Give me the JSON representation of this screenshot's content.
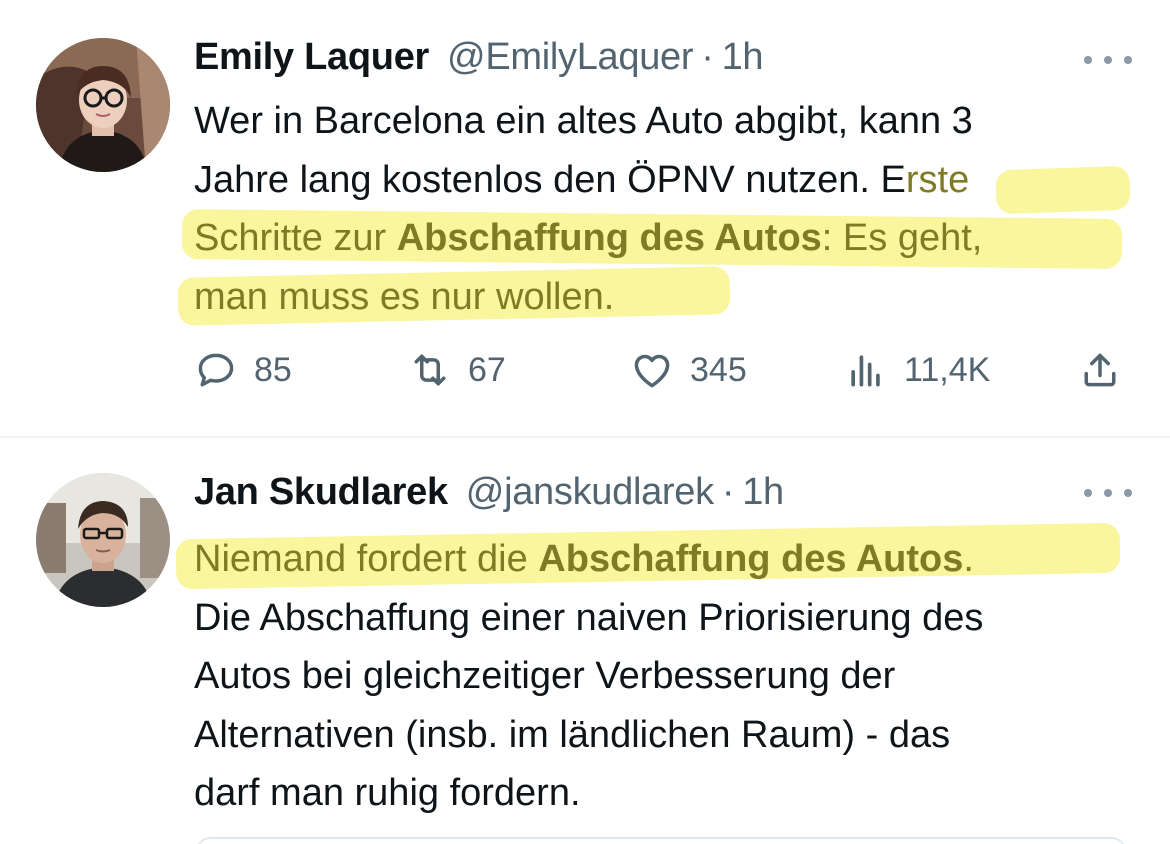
{
  "tweets": [
    {
      "name": "Emily Laquer",
      "handle": "@EmilyLaquer",
      "separator": "·",
      "time": "1h",
      "lines": {
        "l1": "Wer in Barcelona ein altes Auto abgibt, kann 3",
        "l2a": "Jahre lang kostenlos den ÖPNV nutzen. E",
        "l2b": "rste",
        "l3a": "Schritte zur ",
        "l3b": "Abschaffung des Autos",
        "l3c": ": Es geht,",
        "l4": "man muss es nur wollen."
      },
      "stats": {
        "replies": "85",
        "retweets": "67",
        "likes": "345",
        "views": "11,4K"
      },
      "icons": [
        "reply-icon",
        "retweet-icon",
        "like-icon",
        "views-icon",
        "share-icon"
      ]
    },
    {
      "name": "Jan Skudlarek",
      "handle": "@janskudlarek",
      "separator": "·",
      "time": "1h",
      "lines": {
        "l1a": "Niemand fordert die ",
        "l1b": "Abschaffung des Autos",
        "l1c": ".",
        "l2": "Die Abschaffung einer naiven Priorisierung des",
        "l3": "Autos bei gleichzeitiger Verbesserung der",
        "l4": "Alternativen (insb. im ländlichen Raum) - das",
        "l5": "darf man ruhig fordern."
      }
    }
  ],
  "colors": {
    "text": "#0f1419",
    "secondary": "#536471",
    "highlight": "#f8f58d",
    "highlighted_text": "#7f7b25",
    "divider": "#eff3f4"
  }
}
